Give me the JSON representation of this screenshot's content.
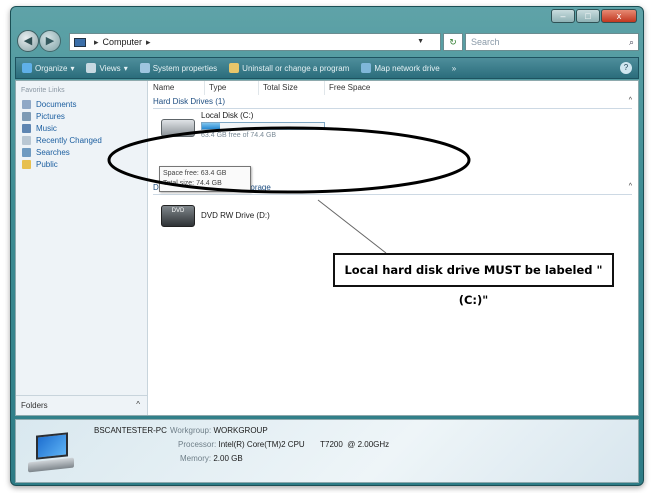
{
  "window": {
    "buttons": [
      "–",
      "□",
      "x"
    ]
  },
  "address": {
    "location": "Computer",
    "search_placeholder": "Search"
  },
  "toolbar": {
    "items": [
      "Organize",
      "Views",
      "System properties",
      "Uninstall or change a program",
      "Map network drive"
    ],
    "more": "»"
  },
  "sidebar": {
    "title": "Favorite Links",
    "items": [
      "Documents",
      "Pictures",
      "Music",
      "Recently Changed",
      "Searches",
      "Public"
    ],
    "folders_label": "Folders"
  },
  "columns": [
    "Name",
    "Type",
    "Total Size",
    "Free Space"
  ],
  "groups": {
    "hard_disk": "Hard Disk Drives (1)",
    "removable": "Devices with Removable Storage"
  },
  "drives": {
    "local": {
      "name": "Local Disk (C:)",
      "free_text": "63.4 GB free of 74.4 GB",
      "used_fraction": 0.15
    },
    "dvd": {
      "name": "DVD RW Drive (D:)",
      "icon_text": "DVD"
    }
  },
  "tooltip": {
    "line1": "Space free: 63.4 GB",
    "line2": "Total size: 74.4 GB"
  },
  "details": {
    "computer_name": "BSCANTESTER-PC",
    "workgroup_label": "Workgroup:",
    "workgroup": "WORKGROUP",
    "processor_label": "Processor:",
    "processor": "Intel(R) Core(TM)2 CPU       T7200  @ 2.00GHz",
    "memory_label": "Memory:",
    "memory": "2.00 GB"
  },
  "annotation": {
    "callout": "Local hard disk drive MUST be labeled \"(C:)\""
  },
  "colors": {
    "frame": "#3d8c93",
    "link": "#1d5fa0",
    "usage_bar": "#2789d2"
  }
}
